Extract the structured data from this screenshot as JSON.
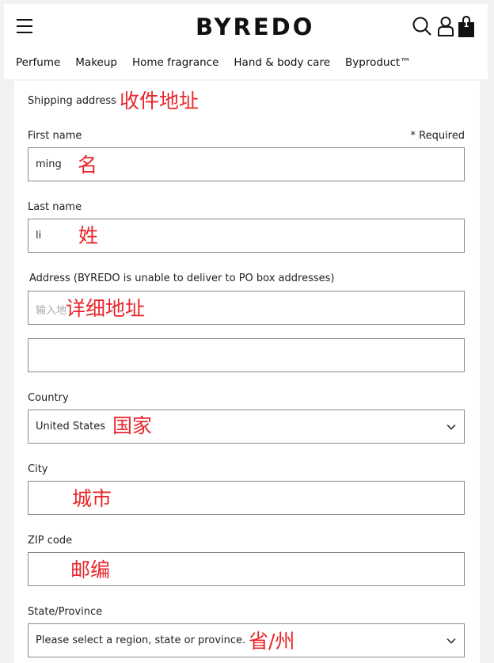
{
  "header": {
    "logo": "BYREDO",
    "bag_count": "1",
    "icons": [
      "hamburger-menu-icon",
      "search-icon",
      "user-icon",
      "shopping-bag-icon"
    ]
  },
  "nav": {
    "items": [
      "Perfume",
      "Makeup",
      "Home fragrance",
      "Hand & body care",
      "Byproduct™"
    ]
  },
  "form": {
    "section_title": "Shipping address",
    "section_note": "收件地址",
    "required": "* Required",
    "first_name": {
      "label": "First name",
      "value": "ming",
      "note": "名"
    },
    "last_name": {
      "label": "Last name",
      "value": "li",
      "note": "姓"
    },
    "address": {
      "label": "Address (BYREDO is unable to deliver to PO box addresses)",
      "placeholder": "输入地",
      "note": "详细地址"
    },
    "address2": {
      "value": ""
    },
    "country": {
      "label": "Country",
      "value": "United States",
      "note": "国家"
    },
    "city": {
      "label": "City",
      "value": "",
      "note": "城市"
    },
    "zip": {
      "label": "ZIP code",
      "value": "",
      "note": "邮编"
    },
    "state": {
      "label": "State/Province",
      "value": "Please select a region, state or province.",
      "note": "省/州"
    }
  },
  "colors": {
    "annotation": "#e8262b",
    "border": "#8a8a8a",
    "background": "#f2f2f2"
  }
}
